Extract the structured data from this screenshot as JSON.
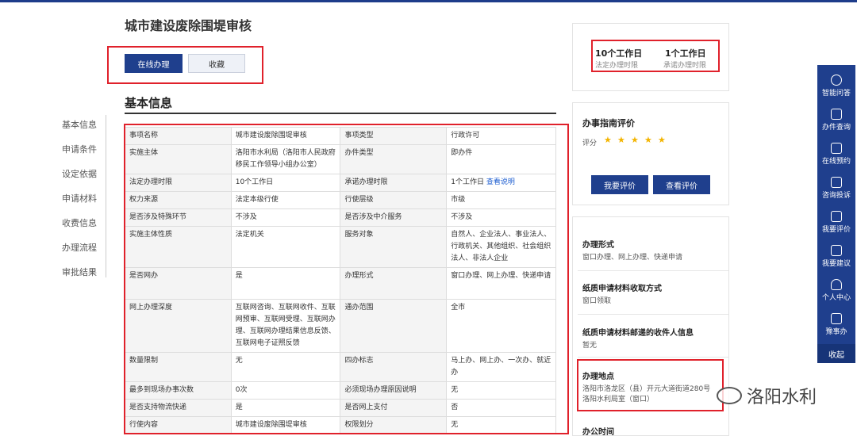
{
  "page": {
    "title": "城市建设废除围堤审核",
    "actions": {
      "online": "在线办理",
      "favorite": "收藏"
    },
    "section_title": "基本信息"
  },
  "leftnav": [
    "基本信息",
    "申请条件",
    "设定依据",
    "申请材料",
    "收费信息",
    "办理流程",
    "审批结果"
  ],
  "table": {
    "rows": [
      {
        "k1": "事项名称",
        "v1": "城市建设废除围堤审核",
        "k2": "事项类型",
        "v2": "行政许可"
      },
      {
        "k1": "实施主体",
        "v1": "洛阳市水利局（洛阳市人民政府移民工作领导小组办公室）",
        "k2": "办件类型",
        "v2": "即办件"
      },
      {
        "k1": "法定办理时限",
        "v1": "10个工作日",
        "k2": "承诺办理时限",
        "v2": "1个工作日",
        "v2_link": "查看说明"
      },
      {
        "k1": "权力来源",
        "v1": "法定本级行使",
        "k2": "行使层级",
        "v2": "市级"
      },
      {
        "k1": "是否涉及特殊环节",
        "v1": "不涉及",
        "k2": "是否涉及中介服务",
        "v2": "不涉及"
      },
      {
        "k1": "实施主体性质",
        "v1": "法定机关",
        "k2": "服务对象",
        "v2": "自然人、企业法人、事业法人、行政机关、其他组织、社会组织法人、非法人企业"
      },
      {
        "k1": "是否网办",
        "v1": "是",
        "k2": "办理形式",
        "v2": "窗口办理、网上办理、快递申请"
      },
      {
        "k1": "网上办理深度",
        "v1": "互联网咨询、互联网收件、互联网预审、互联网受理、互联网办理、互联网办理结果信息反馈、互联网电子证照反馈",
        "k2": "通办范围",
        "v2": "全市"
      },
      {
        "k1": "数量限制",
        "v1": "无",
        "k2": "四办标志",
        "v2": "马上办、网上办、一次办、就近办"
      },
      {
        "k1": "最多到现场办事次数",
        "v1": "0次",
        "k2": "必须现场办理原因说明",
        "v2": "无"
      },
      {
        "k1": "是否支持物流快递",
        "v1": "是",
        "k2": "是否网上支付",
        "v2": "否"
      },
      {
        "k1": "行使内容",
        "v1": "城市建设废除围堤审核",
        "k2": "权限划分",
        "v2": "无"
      }
    ]
  },
  "stats": [
    {
      "value": "10个工作日",
      "label": "法定办理时限"
    },
    {
      "value": "1个工作日",
      "label": "承诺办理时限"
    }
  ],
  "evaluation": {
    "title": "办事指南评价",
    "rating_label": "评分",
    "stars": 5,
    "star_glyph": "★",
    "my_eval": "我要评价",
    "view_eval": "查看评价"
  },
  "side_info": [
    {
      "heading": "办理形式",
      "text": "窗口办理、网上办理、快递申请"
    },
    {
      "heading": "纸质申请材料收取方式",
      "text": "窗口领取"
    },
    {
      "heading": "纸质申请材料邮递的收件人信息",
      "text": "暂无"
    },
    {
      "heading": "办理地点",
      "text1": "洛阳市洛龙区（县）开元大道街道280号",
      "text2": "洛阳水利局室（窗口）"
    },
    {
      "heading": "办公时间"
    }
  ],
  "rightbar": [
    {
      "label": "智能问答",
      "icon": "chat-bot-icon"
    },
    {
      "label": "办件查询",
      "icon": "document-search-icon"
    },
    {
      "label": "在线预约",
      "icon": "calendar-icon"
    },
    {
      "label": "咨询投诉",
      "icon": "message-icon"
    },
    {
      "label": "我要评价",
      "icon": "edit-icon"
    },
    {
      "label": "我要建议",
      "icon": "mail-icon"
    },
    {
      "label": "个人中心",
      "icon": "user-icon"
    },
    {
      "label": "豫事办",
      "icon": "app-icon"
    }
  ],
  "rightbar_collapse": "收起",
  "watermark": "洛阳水利",
  "colors": {
    "primary": "#1f3f8d",
    "highlight_box": "#e0212b",
    "star": "#f3b400"
  }
}
